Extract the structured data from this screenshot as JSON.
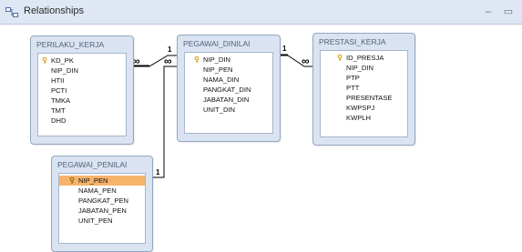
{
  "window": {
    "title": "Relationships",
    "minimize_label": "–",
    "maximize_label": "▭"
  },
  "tables": [
    {
      "name": "PERILAKU_KERJA",
      "fields": [
        {
          "label": "KD_PK",
          "key": true,
          "selected": false
        },
        {
          "label": "NIP_DIN",
          "key": false,
          "selected": false
        },
        {
          "label": "HTII",
          "key": false,
          "selected": false
        },
        {
          "label": "PCTI",
          "key": false,
          "selected": false
        },
        {
          "label": "TMKA",
          "key": false,
          "selected": false
        },
        {
          "label": "TMT",
          "key": false,
          "selected": false
        },
        {
          "label": "DHD",
          "key": false,
          "selected": false
        }
      ]
    },
    {
      "name": "PEGAWAI_DINILAI",
      "fields": [
        {
          "label": "NIP_DIN",
          "key": true,
          "selected": false
        },
        {
          "label": "NIP_PEN",
          "key": false,
          "selected": false
        },
        {
          "label": "NAMA_DIN",
          "key": false,
          "selected": false
        },
        {
          "label": "PANGKAT_DIN",
          "key": false,
          "selected": false
        },
        {
          "label": "JABATAN_DIN",
          "key": false,
          "selected": false
        },
        {
          "label": "UNIT_DIN",
          "key": false,
          "selected": false
        }
      ]
    },
    {
      "name": "PRESTASI_KERJA",
      "fields": [
        {
          "label": "ID_PRESJA",
          "key": true,
          "selected": false
        },
        {
          "label": "NIP_DIN",
          "key": false,
          "selected": false
        },
        {
          "label": "PTP",
          "key": false,
          "selected": false
        },
        {
          "label": "PTT",
          "key": false,
          "selected": false
        },
        {
          "label": "PRESENTASE",
          "key": false,
          "selected": false
        },
        {
          "label": "KWPSPJ",
          "key": false,
          "selected": false
        },
        {
          "label": "KWPLH",
          "key": false,
          "selected": false
        }
      ]
    },
    {
      "name": "PEGAWAI_PENILAI",
      "fields": [
        {
          "label": "NIP_PEN",
          "key": true,
          "selected": true
        },
        {
          "label": "NAMA_PEN",
          "key": false,
          "selected": false
        },
        {
          "label": "PANGKAT_PEN",
          "key": false,
          "selected": false
        },
        {
          "label": "JABATAN_PEN",
          "key": false,
          "selected": false
        },
        {
          "label": "UNIT_PEN",
          "key": false,
          "selected": false
        }
      ]
    }
  ],
  "relationships": [
    {
      "from": "PEGAWAI_DINILAI",
      "to": "PERILAKU_KERJA",
      "one_label": "1",
      "many_label": "∞"
    },
    {
      "from": "PEGAWAI_DINILAI",
      "to": "PRESTASI_KERJA",
      "one_label": "1",
      "many_label": "∞"
    },
    {
      "from": "PEGAWAI_PENILAI",
      "to": "PEGAWAI_DINILAI",
      "one_label": "1",
      "many_label": "∞"
    }
  ],
  "colors": {
    "titlebar": "#dfe7f4",
    "table_frame": "#d9e3f2",
    "selected_row": "#f7b36a",
    "key_icon": "#d4a017"
  }
}
